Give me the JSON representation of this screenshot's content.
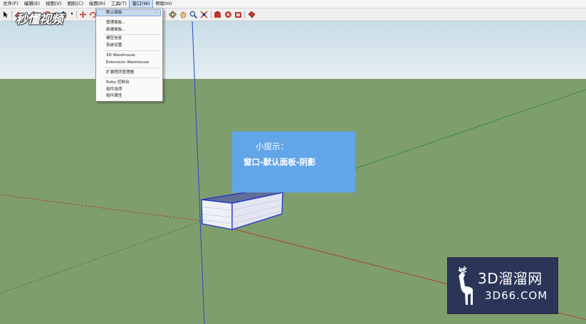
{
  "menubar": {
    "items": [
      {
        "label": "文件(F)"
      },
      {
        "label": "编辑(E)"
      },
      {
        "label": "视图(V)"
      },
      {
        "label": "相机(C)"
      },
      {
        "label": "绘图(R)"
      },
      {
        "label": "工具(T)"
      },
      {
        "label": "窗口(W)",
        "active": true
      },
      {
        "label": "帮助(H)"
      }
    ]
  },
  "window_menu": {
    "items": [
      {
        "label": "默认面板",
        "highlighted": true,
        "submenu_arrow": "›"
      },
      {
        "label": "管理面板..."
      },
      {
        "label": "新建面板..."
      },
      {
        "label": "模型信息"
      },
      {
        "label": "系统设置"
      },
      {
        "label": "3D Warehouse"
      },
      {
        "label": "Extension Warehouse"
      },
      {
        "label": "扩展程序管理器"
      },
      {
        "label": "Ruby 控制台"
      },
      {
        "label": "组件选项"
      },
      {
        "label": "组件属性"
      }
    ]
  },
  "watermark": {
    "text": "秒懂视频"
  },
  "tip": {
    "title": "小提示：",
    "body": "窗口-默认面板-阴影"
  },
  "logo": {
    "name": "3D溜溜网",
    "domain": "3D66.COM"
  },
  "colors": {
    "sky_top": "#c8dde8",
    "ground": "#7f9e6e",
    "tip_bg": "#62a5e8",
    "logo_bg": "#2a3558",
    "axis_red": "#b03a2e",
    "axis_green": "#2f8a2c",
    "axis_blue": "#2747c8"
  }
}
